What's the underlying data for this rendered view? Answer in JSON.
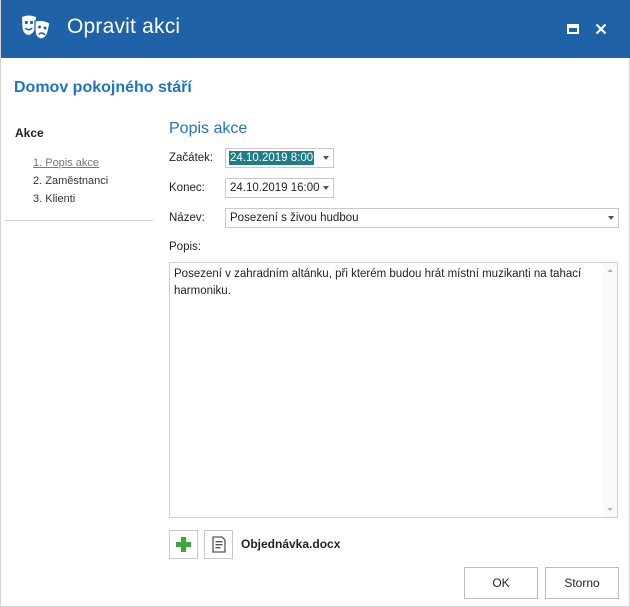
{
  "window": {
    "title": "Opravit akci",
    "colors": {
      "titlebar": "#1f62a8",
      "accent": "#1f73c4"
    },
    "icons": {
      "app": "theater-masks-icon",
      "maximize": "maximize-icon",
      "close": "close-icon"
    }
  },
  "header": {
    "title": "Domov pokojného stáří"
  },
  "sidebar": {
    "heading": "Akce",
    "steps": [
      {
        "label": "1. Popis akce",
        "current": true
      },
      {
        "label": "2. Zaměstnanci",
        "current": false
      },
      {
        "label": "3. Klienti",
        "current": false
      }
    ]
  },
  "form": {
    "section_title": "Popis akce",
    "start": {
      "label": "Začátek:",
      "value": "24.10.2019 8:00"
    },
    "end": {
      "label": "Konec:",
      "value": "24.10.2019 16:00"
    },
    "name": {
      "label": "Název:",
      "value": "Posezení s živou hudbou"
    },
    "description": {
      "label": "Popis:",
      "value": "Posezení v zahradním altánku, při kterém budou hrát místní muzikanti na tahací harmoniku."
    }
  },
  "attachments": {
    "add_icon": "plus-icon",
    "doc_icon": "document-icon",
    "file_name": "Objednávka.docx"
  },
  "buttons": {
    "ok": "OK",
    "cancel": "Storno"
  }
}
